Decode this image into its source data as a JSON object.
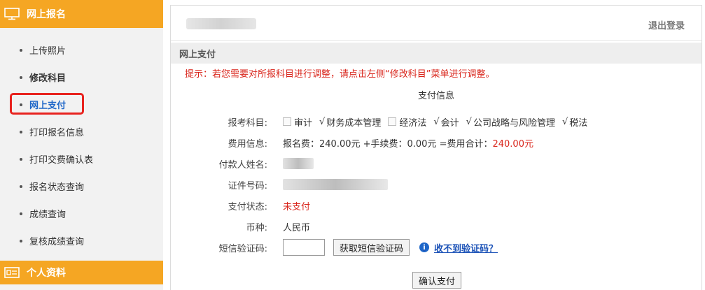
{
  "sidebar": {
    "section1_title": "网上报名",
    "items": [
      {
        "label": "上传照片"
      },
      {
        "label": "修改科目"
      },
      {
        "label": "网上支付"
      },
      {
        "label": "打印报名信息"
      },
      {
        "label": "打印交费确认表"
      },
      {
        "label": "报名状态查询"
      },
      {
        "label": "成绩查询"
      },
      {
        "label": "复核成绩查询"
      }
    ],
    "active_index": 2,
    "section2_title": "个人资料"
  },
  "header": {
    "logout_label": "退出登录"
  },
  "main": {
    "section_title": "网上支付",
    "tip": "提示：若您需要对所报科目进行调整，请点击左侧“修改科目”菜单进行调整。",
    "pay_info_title": "支付信息",
    "subjects_label": "报考科目:",
    "subjects": [
      {
        "name": "审计",
        "checked": false
      },
      {
        "name": "财务成本管理",
        "checked": true
      },
      {
        "name": "经济法",
        "checked": false
      },
      {
        "name": "会计",
        "checked": true
      },
      {
        "name": "公司战略与风险管理",
        "checked": true
      },
      {
        "name": "税法",
        "checked": true
      }
    ],
    "fee_label": "费用信息:",
    "fee_text": "报名费：240.00元 +手续费：0.00元 =费用合计：",
    "fee_total": "240.00元",
    "payer_label": "付款人姓名:",
    "id_label": "证件号码:",
    "status_label": "支付状态:",
    "status_value": "未支付",
    "currency_label": "币种:",
    "currency_value": "人民币",
    "sms_label": "短信验证码:",
    "sms_value": "",
    "get_code_button": "获取短信验证码",
    "help_link": "收不到验证码？",
    "confirm_button": "确认支付"
  },
  "colors": {
    "accent": "#f5a623",
    "highlight_border": "#e8231f",
    "link": "#1e54b8",
    "warning": "#d9261c"
  }
}
